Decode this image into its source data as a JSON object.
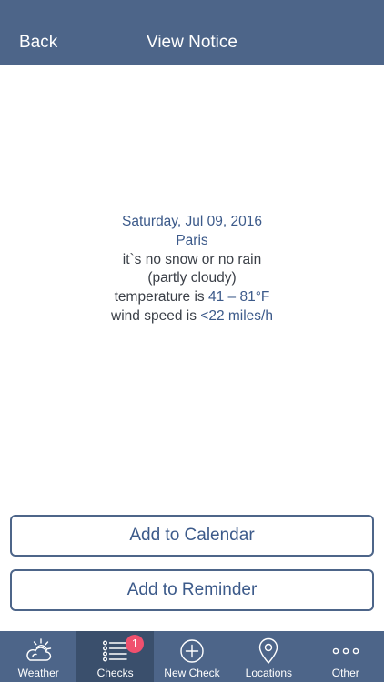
{
  "navbar": {
    "back_label": "Back",
    "title": "View Notice"
  },
  "notice": {
    "date": "Saturday, Jul 09, 2016",
    "city": "Paris",
    "precipitation": "it`s no snow or no rain",
    "sky": "(partly cloudy)",
    "temperature_prefix": "temperature is ",
    "temperature_value": "41 – 81°F",
    "wind_prefix": "wind speed is ",
    "wind_value": "<22 miles/h"
  },
  "actions": {
    "add_calendar_label": "Add to Calendar",
    "add_reminder_label": "Add to Reminder"
  },
  "tabbar": {
    "items": [
      {
        "label": "Weather",
        "icon": "weather-cloud-sun-icon",
        "active": false
      },
      {
        "label": "Checks",
        "icon": "checklist-icon",
        "active": true,
        "badge": "1"
      },
      {
        "label": "New Check",
        "icon": "plus-circle-icon",
        "active": false
      },
      {
        "label": "Locations",
        "icon": "location-pin-icon",
        "active": false
      },
      {
        "label": "Other",
        "icon": "more-dots-icon",
        "active": false
      }
    ]
  },
  "colors": {
    "bar_background": "#4d6589",
    "active_tab_background": "#3a4f6c",
    "accent_text": "#3c5a8a",
    "badge": "#f0506e"
  }
}
